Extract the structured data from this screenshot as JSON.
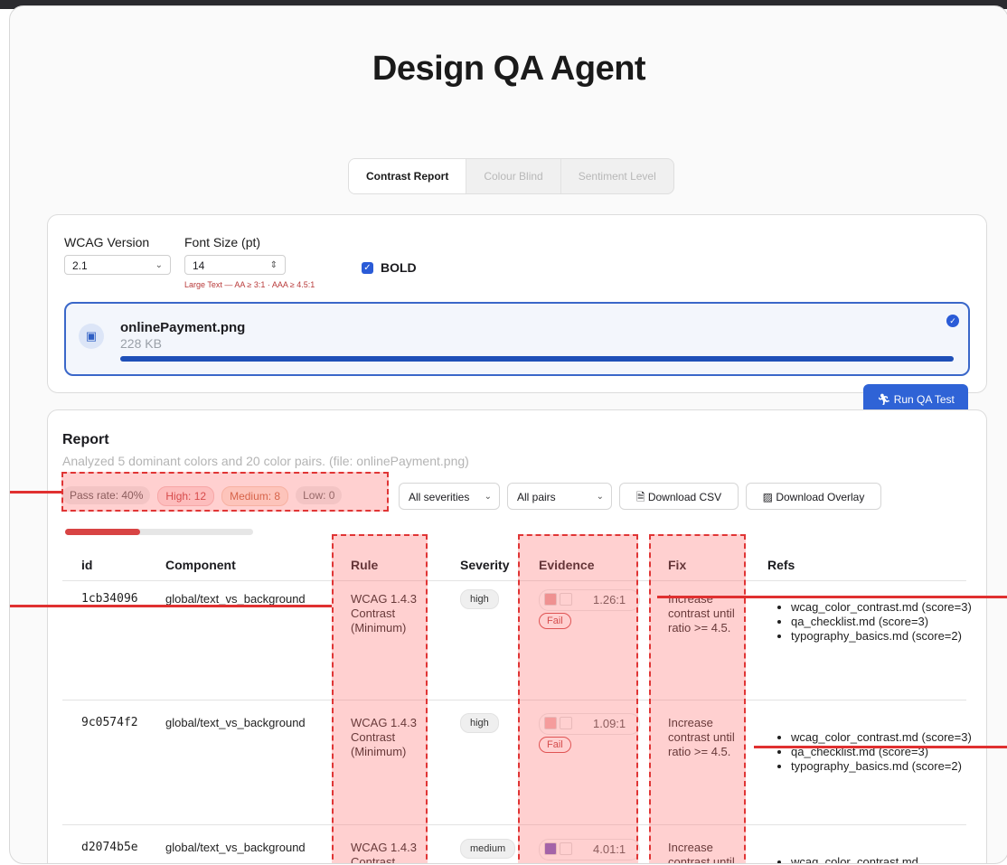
{
  "app": {
    "title": "Design QA Agent"
  },
  "tabs": [
    {
      "label": "Contrast Report",
      "active": true
    },
    {
      "label": "Colour Blind",
      "active": false
    },
    {
      "label": "Sentiment Level",
      "active": false
    }
  ],
  "settings": {
    "wcag_label": "WCAG Version",
    "wcag_value": "2.1",
    "font_label": "Font Size (pt)",
    "font_value": "14",
    "hint": "Large Text — AA ≥ 3:1 · AAA ≥ 4.5:1",
    "bold_label": "BOLD",
    "bold_checked": true
  },
  "file": {
    "name": "onlinePayment.png",
    "size": "228 KB",
    "upload_progress": 1.0
  },
  "run_button": {
    "icon": "run-icon",
    "label": "Run QA Test"
  },
  "report": {
    "title": "Report",
    "subtitle": "Analyzed 5 dominant colors and 20 color pairs. (file: onlinePayment.png)",
    "pass_rate": "Pass rate: 40%",
    "pass_rate_value": 0.4,
    "high": "High: 12",
    "medium": "Medium: 8",
    "low": "Low: 0",
    "severity_filter": "All severities",
    "pairs_filter": "All pairs",
    "download_csv": "Download CSV",
    "download_overlay": "Download Overlay"
  },
  "table": {
    "headers": [
      "id",
      "Component",
      "Rule",
      "Severity",
      "Evidence",
      "Fix",
      "Refs"
    ],
    "rows": [
      {
        "id": "1cb34096",
        "component": "global/text_vs_background",
        "rule": [
          "WCAG 1.4.3",
          "Contrast",
          "(Minimum)"
        ],
        "severity": "high",
        "ratio": "1.26:1",
        "status": "Fail",
        "fix": [
          "Increase",
          "contrast until",
          "ratio >= 4.5."
        ],
        "refs": [
          "wcag_color_contrast.md (score=3)",
          "qa_checklist.md (score=3)",
          "typography_basics.md (score=2)"
        ],
        "swatch_colors": [
          "#e7a3a3",
          "#ffffff"
        ]
      },
      {
        "id": "9c0574f2",
        "component": "global/text_vs_background",
        "rule": [
          "WCAG 1.4.3",
          "Contrast",
          "(Minimum)"
        ],
        "severity": "high",
        "ratio": "1.09:1",
        "status": "Fail",
        "fix": [
          "Increase",
          "contrast until",
          "ratio >= 4.5."
        ],
        "refs": [
          "wcag_color_contrast.md (score=3)",
          "qa_checklist.md (score=3)",
          "typography_basics.md (score=2)"
        ],
        "swatch_colors": [
          "#f0b3b3",
          "#ffffff"
        ]
      },
      {
        "id": "d2074b5e",
        "component": "global/text_vs_background",
        "rule": [
          "WCAG 1.4.3",
          "Contrast"
        ],
        "severity": "medium",
        "ratio": "4.01:1",
        "fix": [
          "Increase",
          "contrast until"
        ],
        "refs": [
          "wcag_color_contrast.md"
        ],
        "swatch_colors": [
          "#7a5fc4",
          "#ffffff"
        ]
      }
    ]
  },
  "colors": {
    "accent": "#2f63d6",
    "highlight": "#e03535",
    "fail": "#c23d3d"
  }
}
